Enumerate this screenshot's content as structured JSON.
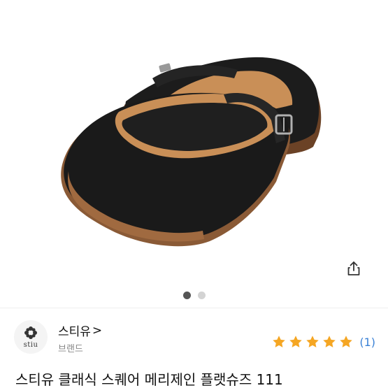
{
  "product": {
    "images": {
      "count": 2,
      "active_index": 0
    },
    "share_icon": "share-icon",
    "title": "스티유 클래식 스퀘어 메리제인 플랫슈즈 111"
  },
  "brand": {
    "name": "스티유",
    "chevron": ">",
    "type_label": "브랜드",
    "logo_text": "stiu"
  },
  "rating": {
    "stars": 5,
    "max_stars": 5,
    "count_label": "(1)",
    "star_color": "#f5a623"
  },
  "colors": {
    "accent_link": "#3b82d6",
    "dot_active": "#555555",
    "dot_inactive": "#d3d3d3"
  }
}
